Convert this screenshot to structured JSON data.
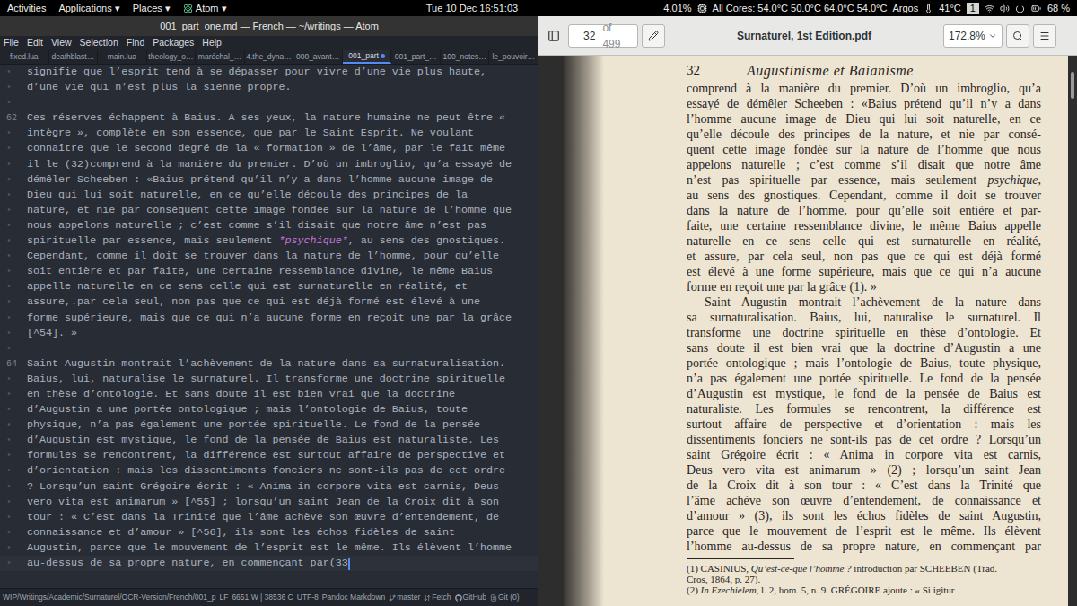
{
  "topbar": {
    "activities": "Activities",
    "menus": [
      {
        "label": "Applications ▾",
        "app_icon": false
      },
      {
        "label": "Places ▾",
        "app_icon": false
      },
      {
        "label": "Atom ▾",
        "app_icon": true
      }
    ],
    "clock": "Tue 10 Dec 16:51:03",
    "cpu_load": "4.01%",
    "temperatures": "All Cores: 54.0°C 50.0°C 64.0°C 54.0°C",
    "argos": "Argos",
    "gpu_temp": "41°C",
    "workspace": "1",
    "battery": "68 %"
  },
  "editor": {
    "title": "001_part_one.md — French — ~/writings — Atom",
    "menu": [
      "File",
      "Edit",
      "View",
      "Selection",
      "Find",
      "Packages",
      "Help"
    ],
    "tabs": [
      {
        "label": "fixed.lua",
        "selected": false,
        "modified": false
      },
      {
        "label": "deathblast…",
        "selected": false,
        "modified": false
      },
      {
        "label": "main.lua",
        "selected": false,
        "modified": false
      },
      {
        "label": "theology_o…",
        "selected": false,
        "modified": false
      },
      {
        "label": "maréchal_…",
        "selected": false,
        "modified": false
      },
      {
        "label": "4.the_dyna…",
        "selected": false,
        "modified": false
      },
      {
        "label": "000_avant…",
        "selected": false,
        "modified": false
      },
      {
        "label": "001_part",
        "selected": true,
        "modified": true
      },
      {
        "label": "001_part_…",
        "selected": false,
        "modified": false
      },
      {
        "label": "100_notes…",
        "selected": false,
        "modified": false
      },
      {
        "label": "le_pouvoir…",
        "selected": false,
        "modified": false
      }
    ],
    "lines": [
      {
        "gutter": "•",
        "text": "signifie que l’esprit tend à se dépasser pour vivre d’une vie plus haute,",
        "current": false,
        "cursor": false
      },
      {
        "gutter": "•",
        "text": "d’une vie qui n’est plus la sienne propre.",
        "current": false,
        "cursor": false
      },
      {
        "gutter": "•",
        "text": "",
        "current": false,
        "cursor": false
      },
      {
        "gutter": "62",
        "text": "Ces réserves échappent à Baius. A ses yeux, la nature humaine ne peut être «",
        "current": false,
        "cursor": false
      },
      {
        "gutter": "•",
        "text": "intègre », complète en son essence, que par le Saint Esprit. Ne voulant",
        "current": false,
        "cursor": false
      },
      {
        "gutter": "•",
        "text": "connaître que le second degré de la « formation » de l’âme, par le fait même",
        "current": false,
        "cursor": false
      },
      {
        "gutter": "•",
        "text": "il le (32)comprend à la manière du premier. D’où un imbroglio, qu’a essayé de",
        "current": false,
        "cursor": false
      },
      {
        "gutter": "•",
        "text": "démêler Scheeben : «Baius prétend qu’il n’y a dans l’homme aucune image de",
        "current": false,
        "cursor": false
      },
      {
        "gutter": "•",
        "text": "Dieu qui lui soit naturelle, en ce qu’elle découle des principes de la",
        "current": false,
        "cursor": false
      },
      {
        "gutter": "•",
        "text": "nature, et nie par conséquent cette image fondée sur la nature de l’homme que",
        "current": false,
        "cursor": false
      },
      {
        "gutter": "•",
        "text": "nous appelons naturelle ; c’est comme s’il disait que notre âme n’est pas",
        "current": false,
        "cursor": false
      },
      {
        "gutter": "•",
        "parts": [
          {
            "text": "spirituelle par essence, mais seulement ",
            "italic": false
          },
          {
            "text": "*psychique*",
            "italic": true
          },
          {
            "text": ", au sens des gnostiques.",
            "italic": false
          }
        ],
        "current": false,
        "cursor": false
      },
      {
        "gutter": "•",
        "text": "Cependant, comme il doit se trouver dans la nature de l’homme, pour qu’elle",
        "current": false,
        "cursor": false
      },
      {
        "gutter": "•",
        "text": "soit entière et par faite, une certaine ressemblance divine, le même Baius",
        "current": false,
        "cursor": false
      },
      {
        "gutter": "•",
        "text": "appelle naturelle en ce sens celle qui est surnaturelle en réalité, et",
        "current": false,
        "cursor": false
      },
      {
        "gutter": "•",
        "text": "assure,.par cela seul, non pas que ce qui est déjà formé est élevé à une",
        "current": false,
        "cursor": false
      },
      {
        "gutter": "•",
        "text": "forme supérieure, mais que ce qui n’a aucune forme en reçoit une par la grâce",
        "current": false,
        "cursor": false
      },
      {
        "gutter": "•",
        "text": "[^54]. »",
        "current": false,
        "cursor": false
      },
      {
        "gutter": "•",
        "text": "",
        "current": false,
        "cursor": false
      },
      {
        "gutter": "64",
        "text": "Saint Augustin montrait l’achèvement de la nature dans sa surnaturalisation.",
        "current": false,
        "cursor": false
      },
      {
        "gutter": "•",
        "text": "Baius, lui, naturalise le surnaturel. Il transforme une doctrine spirituelle",
        "current": false,
        "cursor": false
      },
      {
        "gutter": "•",
        "text": "en thèse d’ontologie. Et sans doute il est bien vrai que la doctrine",
        "current": false,
        "cursor": false
      },
      {
        "gutter": "•",
        "text": "d’Augustin a une portée ontologique ; mais l’ontologie de Baius, toute",
        "current": false,
        "cursor": false
      },
      {
        "gutter": "•",
        "text": "physique, n’a pas également une portée spirituelle. Le fond de la pensée",
        "current": false,
        "cursor": false
      },
      {
        "gutter": "•",
        "text": "d’Augustin est mystique, le fond de la pensée de Baius est naturaliste. Les",
        "current": false,
        "cursor": false
      },
      {
        "gutter": "•",
        "text": "formules se rencontrent, la différence est surtout affaire de perspective et",
        "current": false,
        "cursor": false
      },
      {
        "gutter": "•",
        "text": "d’orientation : mais les dissentiments fonciers ne sont-ils pas de cet ordre",
        "current": false,
        "cursor": false
      },
      {
        "gutter": "•",
        "text": "? Lorsqu’un saint Grégoire écrit : « Anima in corpore vita est carnis, Deus",
        "current": false,
        "cursor": false
      },
      {
        "gutter": "•",
        "text": "vero vita est animarum » [^55] ; lorsqu’un saint Jean de la Croix dit à son",
        "current": false,
        "cursor": false
      },
      {
        "gutter": "•",
        "text": "tour : « C’est dans la Trinité que l’âme achève son œuvre d’entendement, de",
        "current": false,
        "cursor": false
      },
      {
        "gutter": "•",
        "text": "connaissance et d’amour » [^56], ils sont les échos fidèles de saint",
        "current": false,
        "cursor": false
      },
      {
        "gutter": "•",
        "text": "Augustin, parce que le mouvement de l’esprit est le même. Ils élèvent l’homme",
        "current": false,
        "cursor": false
      },
      {
        "gutter": "•",
        "text": "au-dessus de sa propre nature, en commençant par(33",
        "current": true,
        "cursor": true
      }
    ],
    "status": {
      "path": "WIP/Writings/Academic/Surnaturel/OCR-Version/French/001_p",
      "eol": "LF",
      "counts": "6651 W | 38536 C",
      "encoding": "UTF-8",
      "grammar": "Pandoc Markdown",
      "branch": "master",
      "fetch": "Fetch",
      "github": "GitHub",
      "git": "Git (0)"
    }
  },
  "viewer": {
    "page_entry": "32",
    "page_total": "of 499",
    "title": "Surnaturel, 1st Edition.pdf",
    "zoom": "172.8%",
    "page": {
      "number": "32",
      "running_head": "Augustinisme et Baianisme",
      "body": [
        {
          "text": "comprend à la manière du premier. D’où un imbroglio, qu’a",
          "indent": false,
          "paragraph_end": false
        },
        {
          "text": "essayé de démêler Scheeben : «Baius prétend qu’il n’y a dans",
          "indent": false,
          "paragraph_end": false
        },
        {
          "text": "l’homme aucune image de Dieu qui lui soit naturelle, en ce",
          "indent": false,
          "paragraph_end": false
        },
        {
          "text": "qu’elle découle des principes de la nature, et nie par consé-",
          "indent": false,
          "paragraph_end": false
        },
        {
          "text": "quent cette image fondée sur la nature de l’homme que nous",
          "indent": false,
          "paragraph_end": false
        },
        {
          "text": "appelons naturelle ; c’est comme s’il disait que notre âme",
          "indent": false,
          "paragraph_end": false
        },
        {
          "parts": [
            {
              "text": "n’est pas spirituelle par essence, mais seulement ",
              "italic": false
            },
            {
              "text": "psychique",
              "italic": true
            },
            {
              "text": ",",
              "italic": false
            }
          ],
          "indent": false,
          "paragraph_end": false
        },
        {
          "text": "au sens des gnostiques. Cependant, comme il doit se trouver",
          "indent": false,
          "paragraph_end": false
        },
        {
          "text": "dans la nature de l’homme, pour qu’elle soit entière et par-",
          "indent": false,
          "paragraph_end": false
        },
        {
          "text": "faite, une certaine ressemblance divine, le même Baius appelle",
          "indent": false,
          "paragraph_end": false
        },
        {
          "text": "naturelle en ce sens celle qui est surnaturelle en réalité,",
          "indent": false,
          "paragraph_end": false
        },
        {
          "text": "et assure, par cela seul, non pas que ce qui est déjà formé",
          "indent": false,
          "paragraph_end": false
        },
        {
          "text": "est élevé à une forme supérieure, mais que ce qui n’a aucune",
          "indent": false,
          "paragraph_end": false
        },
        {
          "text": "forme en reçoit une par la grâce (1). »",
          "indent": false,
          "paragraph_end": true
        },
        {
          "text": "Saint Augustin montrait l’achèvement de la nature dans",
          "indent": true,
          "paragraph_end": false
        },
        {
          "text": "sa surnaturalisation. Baius, lui, naturalise le surnaturel. Il",
          "indent": false,
          "paragraph_end": false
        },
        {
          "text": "transforme une doctrine spirituelle en thèse d’ontologie. Et",
          "indent": false,
          "paragraph_end": false
        },
        {
          "text": "sans doute il est bien vrai que la doctrine d’Augustin a une",
          "indent": false,
          "paragraph_end": false
        },
        {
          "text": "portée ontologique ; mais l’ontologie de Baius, toute physique,",
          "indent": false,
          "paragraph_end": false
        },
        {
          "text": "n’a pas également une portée spirituelle. Le fond de la pensée",
          "indent": false,
          "paragraph_end": false
        },
        {
          "text": "d’Augustin est mystique, le fond de la pensée de Baius est",
          "indent": false,
          "paragraph_end": false
        },
        {
          "text": "naturaliste. Les formules se rencontrent, la différence est",
          "indent": false,
          "paragraph_end": false
        },
        {
          "text": "surtout affaire de perspective et d’orientation : mais les",
          "indent": false,
          "paragraph_end": false
        },
        {
          "text": "dissentiments fonciers ne sont-ils pas de cet ordre ? Lorsqu’un",
          "indent": false,
          "paragraph_end": false
        },
        {
          "text": "saint Grégoire écrit : « Anima in corpore vita est carnis,",
          "indent": false,
          "paragraph_end": false
        },
        {
          "text": "Deus vero vita est animarum » (2) ; lorsqu’un saint Jean",
          "indent": false,
          "paragraph_end": false
        },
        {
          "text": "de la Croix dit à son tour : « C’est dans la Trinité que",
          "indent": false,
          "paragraph_end": false
        },
        {
          "text": "l’âme achève son œuvre d’entendement, de connaissance et",
          "indent": false,
          "paragraph_end": false
        },
        {
          "text": "d’amour » (3), ils sont les échos fidèles de saint Augustin,",
          "indent": false,
          "paragraph_end": false
        },
        {
          "text": "parce que le mouvement de l’esprit est le même. Ils élèvent",
          "indent": false,
          "paragraph_end": false
        },
        {
          "text": "l’homme au-dessus de sa propre nature, en commençant par",
          "indent": false,
          "paragraph_end": false
        }
      ],
      "footnotes": [
        {
          "parts": [
            {
              "text": "(1) CASINIUS, ",
              "italic": false
            },
            {
              "text": "Qu’est-ce-que l’homme ?",
              "italic": true
            },
            {
              "text": " introduction par SCHEEBEN (Trad.",
              "italic": false
            }
          ]
        },
        {
          "text": "Cros, 1864, p. 27)."
        },
        {
          "parts": [
            {
              "text": "(2) ",
              "italic": false
            },
            {
              "text": "In Ezechielem",
              "italic": true
            },
            {
              "text": ", l. 2, hom. 5, n. 9. GRÉGOIRE ajoute : « Si igitur",
              "italic": false
            }
          ]
        }
      ]
    }
  }
}
